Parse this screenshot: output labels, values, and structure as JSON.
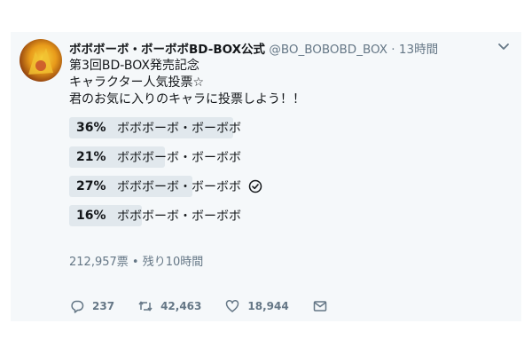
{
  "tweet": {
    "display_name": "ボボボーボ・ボーボボBD-BOX公式",
    "handle": "@BO_BOBOBD_BOX",
    "separator": "·",
    "time": "13時間",
    "lines": [
      "第3回BD-BOX発売記念",
      "キャラクター人気投票☆",
      "君のお気に入りのキャラに投票しよう！！"
    ]
  },
  "poll": {
    "options": [
      {
        "percent_label": "36%",
        "percent": 36,
        "label": "ボボボーボ・ボーボボ",
        "voted": false
      },
      {
        "percent_label": "21%",
        "percent": 21,
        "label": "ボボボーボ・ボーボボ",
        "voted": false
      },
      {
        "percent_label": "27%",
        "percent": 27,
        "label": "ボボボーボ・ボーボボ",
        "voted": true
      },
      {
        "percent_label": "16%",
        "percent": 16,
        "label": "ボボボーボ・ボーボボ",
        "voted": false
      }
    ],
    "summary": "212,957票 • 残り10時間"
  },
  "actions": {
    "reply_count": "237",
    "retweet_count": "42,463",
    "like_count": "18,944"
  },
  "colors": {
    "card_bg": "#f5f8fa",
    "bar": "#e1e8ed",
    "muted": "#657786",
    "text": "#14171a"
  },
  "icons": [
    "avatar",
    "chevron-down-icon",
    "check-circle-icon",
    "reply-icon",
    "retweet-icon",
    "like-icon",
    "message-icon"
  ]
}
